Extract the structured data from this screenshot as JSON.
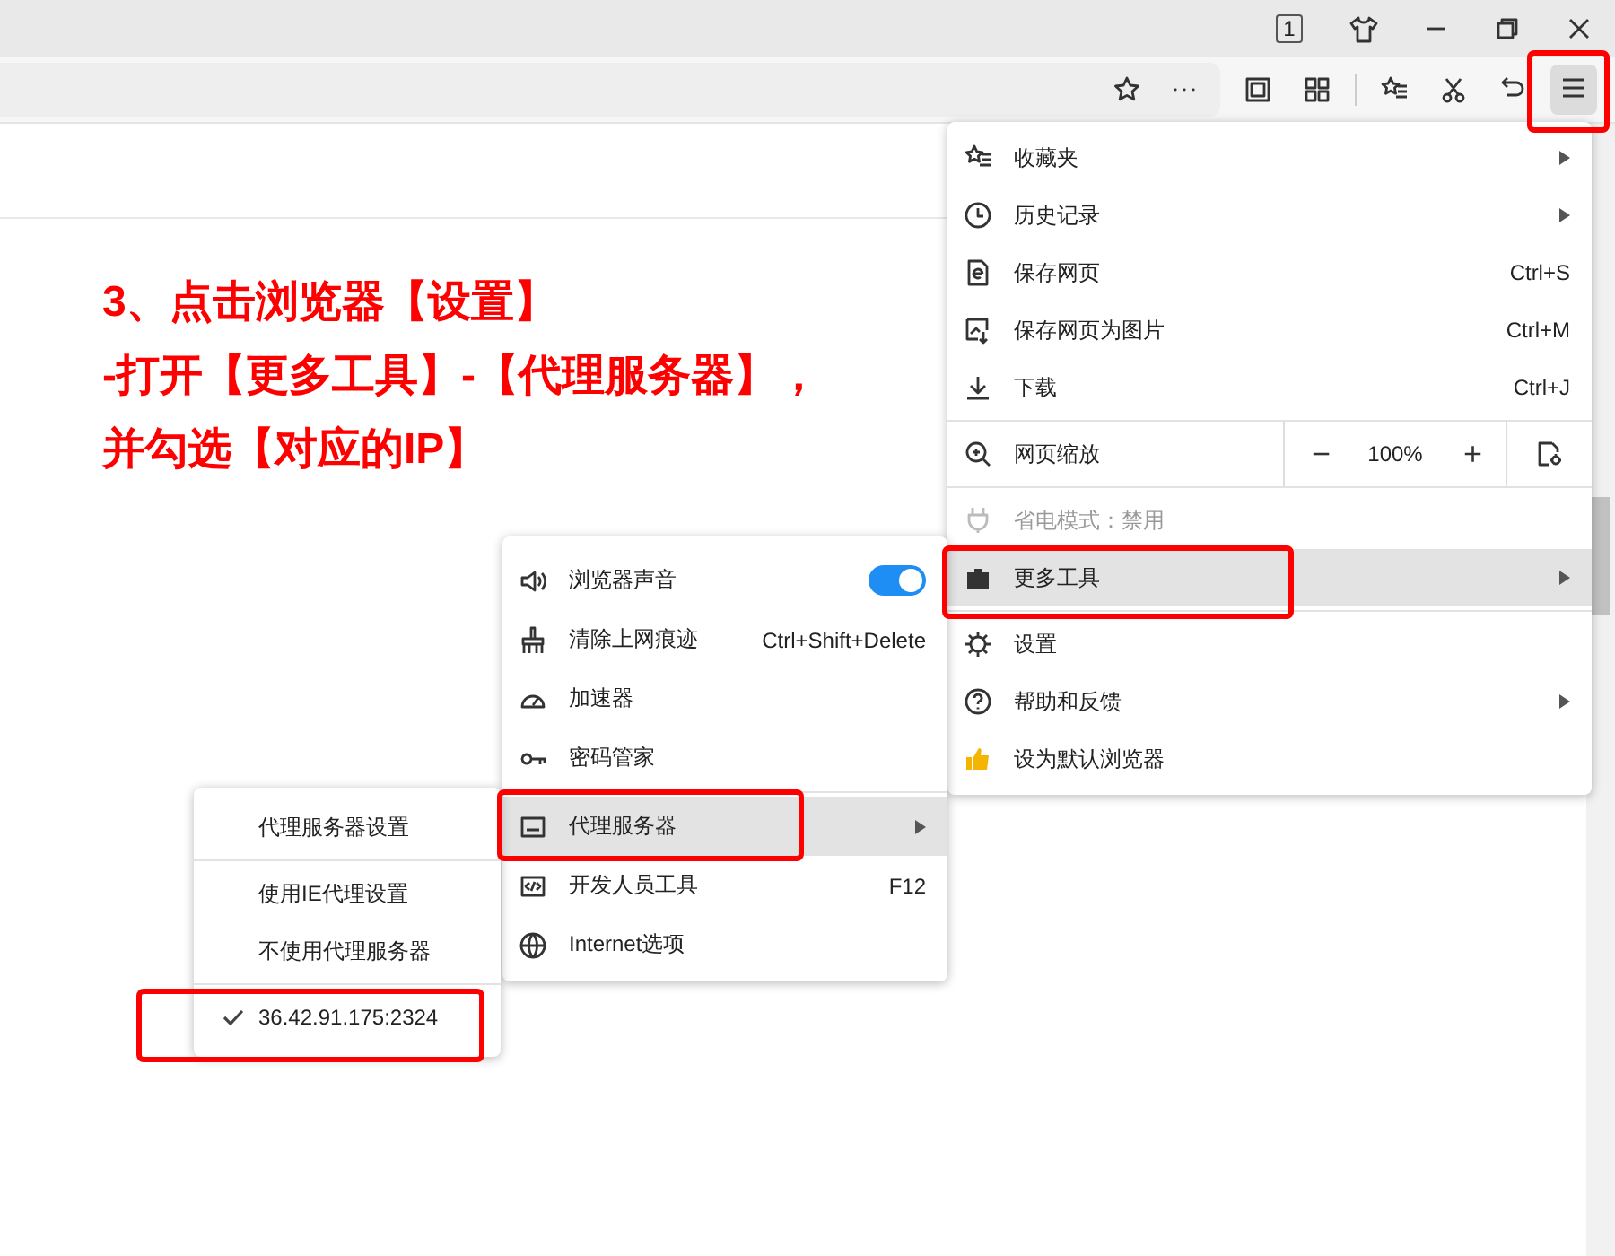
{
  "title_bar": {
    "tab_count": "1"
  },
  "annotation": {
    "lines": [
      "3、点击浏览器【设置】",
      "-打开【更多工具】-【代理服务器】，",
      "并勾选【对应的IP】"
    ]
  },
  "main_menu": {
    "items": [
      {
        "kind": "item",
        "label": "收藏夹",
        "submenu": true,
        "disabled": false,
        "selected": false
      },
      {
        "kind": "item",
        "label": "历史记录",
        "submenu": true,
        "disabled": false,
        "selected": false
      },
      {
        "kind": "item",
        "label": "保存网页",
        "shortcut": "Ctrl+S",
        "submenu": false,
        "disabled": false,
        "selected": false
      },
      {
        "kind": "item",
        "label": "保存网页为图片",
        "shortcut": "Ctrl+M",
        "submenu": false,
        "disabled": false,
        "selected": false
      },
      {
        "kind": "item",
        "label": "下载",
        "shortcut": "Ctrl+J",
        "submenu": false,
        "disabled": false,
        "selected": false
      },
      {
        "kind": "separator"
      },
      {
        "kind": "zoom",
        "label": "网页缩放",
        "minus": "−",
        "value": "100%",
        "plus": "+"
      },
      {
        "kind": "separator"
      },
      {
        "kind": "item",
        "label": "省电模式：禁用",
        "submenu": false,
        "disabled": true,
        "selected": false
      },
      {
        "kind": "item",
        "label": "更多工具",
        "submenu": true,
        "disabled": false,
        "selected": true
      },
      {
        "kind": "separator"
      },
      {
        "kind": "item",
        "label": "设置",
        "submenu": false,
        "disabled": false,
        "selected": false
      },
      {
        "kind": "item",
        "label": "帮助和反馈",
        "submenu": true,
        "disabled": false,
        "selected": false
      },
      {
        "kind": "item",
        "label": "设为默认浏览器",
        "submenu": false,
        "disabled": false,
        "selected": false
      }
    ]
  },
  "tools_menu": {
    "items": [
      {
        "kind": "toggle",
        "label": "浏览器声音",
        "on": true,
        "submenu": false,
        "selected": false
      },
      {
        "kind": "item",
        "label": "清除上网痕迹",
        "shortcut": "Ctrl+Shift+Delete",
        "submenu": false,
        "selected": false
      },
      {
        "kind": "item",
        "label": "加速器",
        "submenu": false,
        "selected": false
      },
      {
        "kind": "item",
        "label": "密码管家",
        "submenu": false,
        "selected": false
      },
      {
        "kind": "separator"
      },
      {
        "kind": "item",
        "label": "代理服务器",
        "submenu": true,
        "selected": true
      },
      {
        "kind": "item",
        "label": "开发人员工具",
        "shortcut": "F12",
        "submenu": false,
        "selected": false
      },
      {
        "kind": "item",
        "label": "Internet选项",
        "submenu": false,
        "selected": false
      }
    ]
  },
  "proxy_menu": {
    "items": [
      {
        "kind": "item",
        "label": "代理服务器设置",
        "checked": false
      },
      {
        "kind": "separator"
      },
      {
        "kind": "item",
        "label": "使用IE代理设置",
        "checked": false
      },
      {
        "kind": "item",
        "label": "不使用代理服务器",
        "checked": false
      },
      {
        "kind": "separator"
      },
      {
        "kind": "item",
        "label": "36.42.91.175:2324",
        "checked": true
      }
    ]
  }
}
